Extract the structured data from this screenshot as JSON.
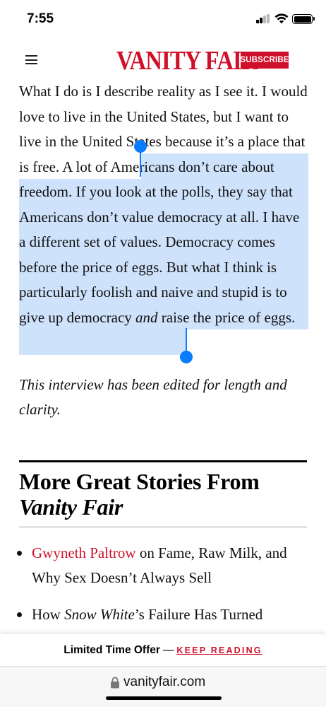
{
  "status_bar": {
    "time": "7:55"
  },
  "header": {
    "logo": "VANITY FAIR",
    "subscribe_label": "SUBSCRIBE"
  },
  "article": {
    "line1": "What I do is I describe reality as I see it. I would love to live in the United States, but I want to live in the United States because it’s a place that is free.",
    "selected_part1": "A lot of Americans don’t care about freedom. If you look at the polls, they say that Americans don’t value democracy at all. I have a different set of values. Democracy comes before the price of eggs. But what I think is particularly foolish and naive and stupid is to give up democracy ",
    "selected_em": "and",
    "selected_part2": " raise the price of eggs."
  },
  "note": "This interview has been edited for length and clarity.",
  "more_section": {
    "title": "More Great Stories From",
    "brand": "Vanity Fair",
    "stories": [
      {
        "link": "Gwyneth Paltrow",
        "rest": " on Fame, Raw Milk, and Why Sex Doesn’t Always Sell"
      },
      {
        "prefix": "How ",
        "em": "Snow White",
        "rest": "’s Failure Has Turned"
      }
    ]
  },
  "offer_bar": {
    "label": "Limited Time Offer",
    "dash": "—",
    "link": "KEEP READING"
  },
  "address_bar": {
    "url": "vanityfair.com"
  },
  "colors": {
    "brand_red": "#d0102a",
    "selection": "#cfe2fb",
    "handle_blue": "#0a7cff"
  }
}
